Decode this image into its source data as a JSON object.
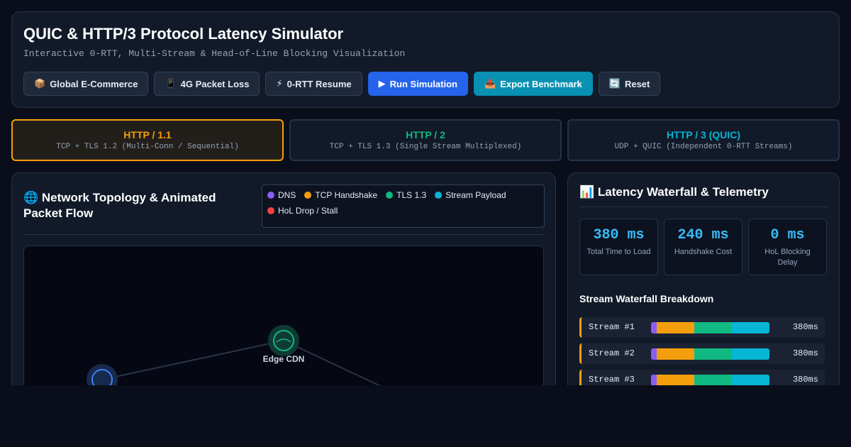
{
  "header": {
    "title": "QUIC & HTTP/3 Protocol Latency Simulator",
    "subtitle": "Interactive 0-RTT, Multi-Stream & Head-of-Line Blocking Visualization"
  },
  "toolbar": {
    "buttons": [
      {
        "icon": "📦",
        "label": "Global E-Commerce"
      },
      {
        "icon": "📱",
        "label": "4G Packet Loss"
      },
      {
        "icon": "⚡",
        "label": "0-RTT Resume"
      },
      {
        "icon": "▶",
        "label": "Run Simulation"
      },
      {
        "icon": "📤",
        "label": "Export Benchmark"
      },
      {
        "icon": "🔄",
        "label": "Reset"
      }
    ]
  },
  "protocols": [
    {
      "name": "HTTP / 1.1",
      "desc": "TCP + TLS 1.2 (Multi-Conn / Sequential)",
      "color": "#f59e0b",
      "active": true
    },
    {
      "name": "HTTP / 2",
      "desc": "TCP + TLS 1.3 (Single Stream Multiplexed)",
      "color": "#10b981",
      "active": false
    },
    {
      "name": "HTTP / 3 (QUIC)",
      "desc": "UDP + QUIC (Independent 0-RTT Streams)",
      "color": "#06b6d4",
      "active": false
    }
  ],
  "topology": {
    "icon": "🌐",
    "title": "Network Topology & Animated Packet Flow",
    "legend": [
      {
        "label": "DNS",
        "color": "#8b5cf6"
      },
      {
        "label": "TCP Handshake",
        "color": "#f59e0b"
      },
      {
        "label": "TLS 1.3",
        "color": "#10b981"
      },
      {
        "label": "Stream Payload",
        "color": "#06b6d4"
      },
      {
        "label": "HoL Drop / Stall",
        "color": "#ef4444"
      }
    ],
    "nodes": {
      "edge": "Edge CDN"
    }
  },
  "telemetry": {
    "icon": "📊",
    "title": "Latency Waterfall & Telemetry",
    "metrics": [
      {
        "value": "380 ms",
        "label": "Total Time to Load"
      },
      {
        "value": "240 ms",
        "label": "Handshake Cost"
      },
      {
        "value": "0 ms",
        "label": "HoL Blocking Delay"
      }
    ],
    "waterfall_title": "Stream Waterfall Breakdown",
    "streams": [
      {
        "label": "Stream #1",
        "total": "380ms",
        "phases_ms": {
          "dns": 10,
          "tcp": 70,
          "tls": 70,
          "payload": 70
        }
      },
      {
        "label": "Stream #2",
        "total": "380ms",
        "phases_ms": {
          "dns": 10,
          "tcp": 70,
          "tls": 70,
          "payload": 70
        }
      },
      {
        "label": "Stream #3",
        "total": "380ms",
        "phases_ms": {
          "dns": 10,
          "tcp": 70,
          "tls": 70,
          "payload": 70
        }
      }
    ]
  }
}
